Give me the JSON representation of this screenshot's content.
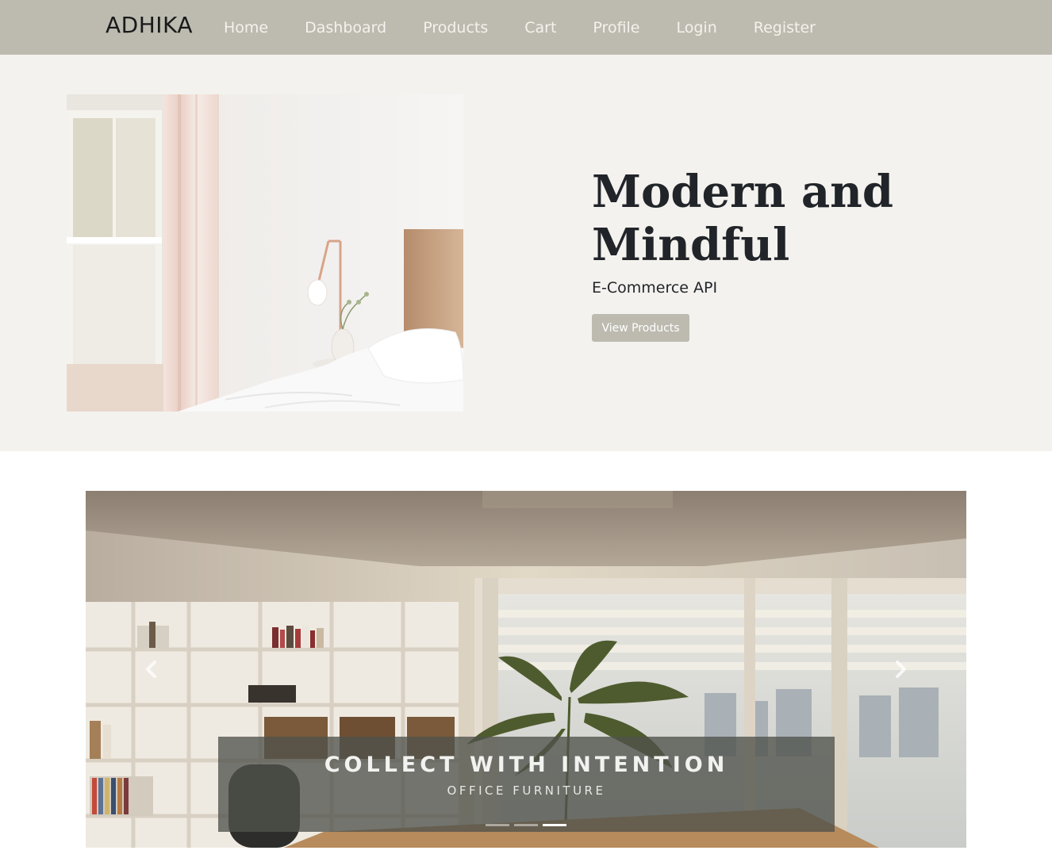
{
  "navbar": {
    "brand": "ADHIKA",
    "links": [
      {
        "label": "Home"
      },
      {
        "label": "Dashboard"
      },
      {
        "label": "Products"
      },
      {
        "label": "Cart"
      },
      {
        "label": "Profile"
      },
      {
        "label": "Login"
      },
      {
        "label": "Register"
      }
    ],
    "background_color": "#bdbbb0"
  },
  "hero": {
    "title": "Modern and Mindful",
    "subtitle": "E-Commerce API",
    "button_label": "View Products",
    "image_alt": "bedroom-with-curtains-lamp-and-bed",
    "background_color": "#f4f2ee"
  },
  "carousel": {
    "caption_title": "COLLECT WITH INTENTION",
    "caption_subtitle": "OFFICE FURNITURE",
    "image_alt": "office-room-with-bookshelves-plant-and-window",
    "prev_icon": "chevron-left-icon",
    "next_icon": "chevron-right-icon",
    "slide_count": 3,
    "active_slide": 3
  }
}
